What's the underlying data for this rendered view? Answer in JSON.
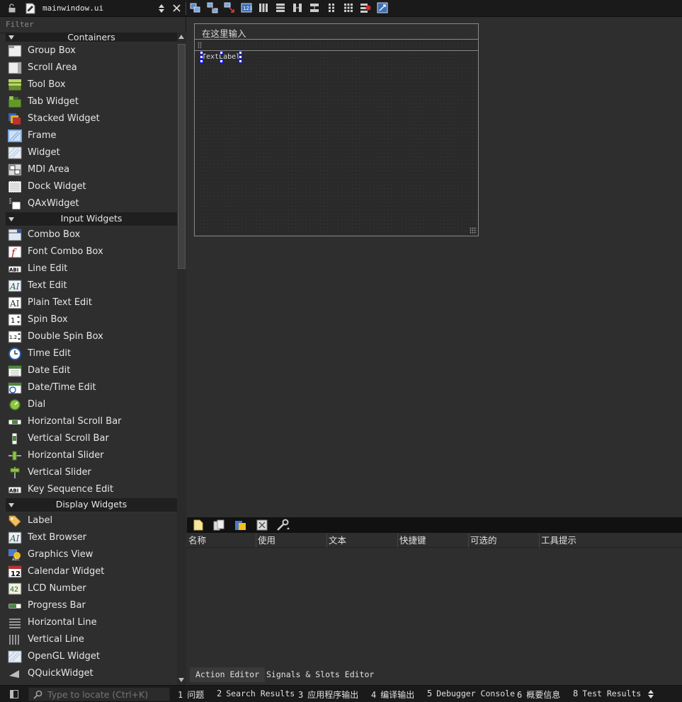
{
  "file": {
    "name": "mainwindow.ui"
  },
  "filter": {
    "placeholder": "Filter"
  },
  "categories": {
    "containers": "Containers",
    "input": "Input Widgets",
    "display": "Display Widgets"
  },
  "containers_items": [
    "Group Box",
    "Scroll Area",
    "Tool Box",
    "Tab Widget",
    "Stacked Widget",
    "Frame",
    "Widget",
    "MDI Area",
    "Dock Widget",
    "QAxWidget"
  ],
  "input_items": [
    "Combo Box",
    "Font Combo Box",
    "Line Edit",
    "Text Edit",
    "Plain Text Edit",
    "Spin Box",
    "Double Spin Box",
    "Time Edit",
    "Date Edit",
    "Date/Time Edit",
    "Dial",
    "Horizontal Scroll Bar",
    "Vertical Scroll Bar",
    "Horizontal Slider",
    "Vertical Slider",
    "Key Sequence Edit"
  ],
  "display_items": [
    "Label",
    "Text Browser",
    "Graphics View",
    "Calendar Widget",
    "LCD Number",
    "Progress Bar",
    "Horizontal Line",
    "Vertical Line",
    "OpenGL Widget",
    "QQuickWidget"
  ],
  "form": {
    "menu_placeholder": "在这里输入",
    "text_label": "TextLabel"
  },
  "action_editor": {
    "columns": [
      "名称",
      "使用",
      "文本",
      "快捷键",
      "可选的",
      "工具提示"
    ]
  },
  "bottom_tabs": {
    "action": "Action Editor",
    "signals": "Signals & Slots Editor"
  },
  "status": {
    "locate_placeholder": "Type to locate (Ctrl+K)",
    "panes": [
      {
        "num": "1",
        "label": "问题"
      },
      {
        "num": "2",
        "label": "Search Results"
      },
      {
        "num": "3",
        "label": "应用程序输出"
      },
      {
        "num": "4",
        "label": "编译输出"
      },
      {
        "num": "5",
        "label": "Debugger Console"
      },
      {
        "num": "6",
        "label": "概要信息"
      },
      {
        "num": "8",
        "label": "Test Results"
      }
    ]
  }
}
